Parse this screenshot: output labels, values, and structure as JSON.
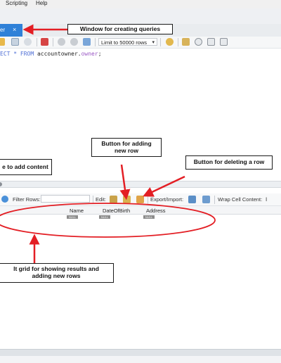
{
  "menu": {
    "items": [
      "Scripting",
      "Help"
    ]
  },
  "tab": {
    "label": "er",
    "close": "×"
  },
  "toolbar": {
    "limit_label": "Limit to 50000 rows"
  },
  "editor": {
    "line_kw": "ECT * FROM ",
    "line_table": "accountowner.",
    "line_table2": "owner",
    "line_end": ";"
  },
  "results_toolbar": {
    "filter_label": "Filter Rows:",
    "edit_label": "Edit:",
    "export_label": "Export/Import:",
    "wrap_label": "Wrap Cell Content:"
  },
  "grid": {
    "columns": [
      "Name",
      "DateOfBirth",
      "Address"
    ],
    "null_label": "NULL"
  },
  "annotations": {
    "window_note": "Window for creating queries",
    "add_row_note": "Button for adding new row",
    "delete_row_note": "Button for deleting a row",
    "editor_note": "e to add content",
    "grid_note": "lt grid for showing results and adding new rows"
  },
  "colors": {
    "tab_blue": "#2f81d8",
    "annotation_red": "#e31e24",
    "keyword_blue": "#4f6fd6",
    "table_purple": "#9b58c5"
  }
}
